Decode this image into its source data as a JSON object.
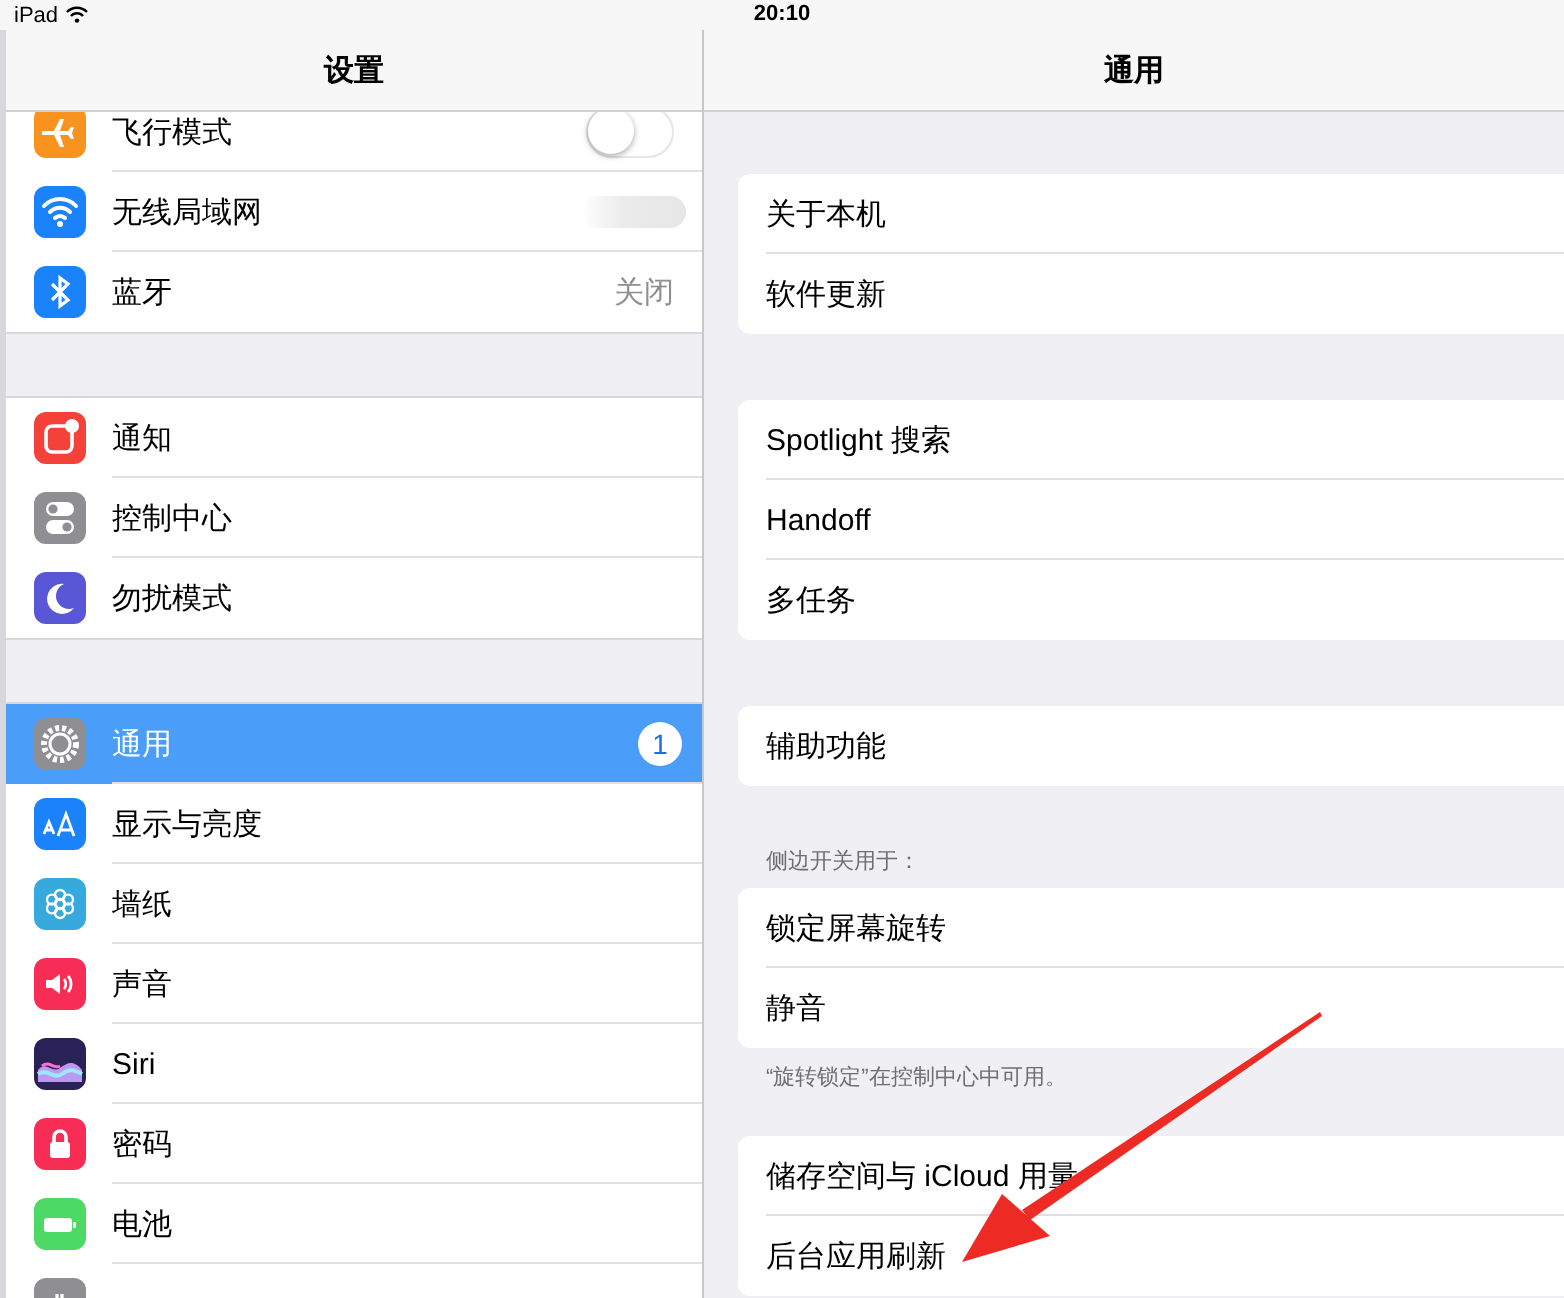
{
  "status_bar": {
    "device": "iPad",
    "time": "20:10"
  },
  "sidebar": {
    "title": "设置",
    "groups": [
      {
        "items": [
          {
            "kind": "airplane",
            "color": "#f7931e",
            "label": "飞行模式",
            "selected": false,
            "toggle": {
              "on": false
            }
          },
          {
            "kind": "wifi",
            "color": "#1a82fb",
            "label": "无线局域网",
            "selected": false,
            "blurred": true
          },
          {
            "kind": "bluetooth",
            "color": "#1a82fb",
            "label": "蓝牙",
            "selected": false,
            "value": "关闭"
          }
        ]
      },
      {
        "items": [
          {
            "kind": "notice",
            "color": "#f4413a",
            "label": "通知",
            "selected": false
          },
          {
            "kind": "switches",
            "color": "#8e8e93",
            "label": "控制中心",
            "selected": false
          },
          {
            "kind": "moon",
            "color": "#5a57d6",
            "label": "勿扰模式",
            "selected": false
          }
        ]
      },
      {
        "items": [
          {
            "kind": "gear",
            "color": "#8e8e93",
            "label": "通用",
            "selected": true,
            "badge": "1"
          },
          {
            "kind": "text-size",
            "color": "#1a82fb",
            "label": "显示与亮度",
            "selected": false
          },
          {
            "kind": "flower",
            "color": "#36aadc",
            "label": "墙纸",
            "selected": false
          },
          {
            "kind": "speaker",
            "color": "#f72d55",
            "label": "声音",
            "selected": false
          },
          {
            "kind": "siri",
            "color": "#2a2257",
            "label": "Siri",
            "selected": false
          },
          {
            "kind": "lock",
            "color": "#f72d55",
            "label": "密码",
            "selected": false
          },
          {
            "kind": "battery",
            "color": "#4cd964",
            "label": "电池",
            "selected": false
          },
          {
            "kind": "hand",
            "color": "#8e8e93",
            "selected": false
          }
        ]
      }
    ]
  },
  "detail": {
    "title": "通用",
    "groups": [
      {
        "items": [
          {
            "label": "关于本机"
          },
          {
            "label": "软件更新"
          }
        ]
      },
      {
        "items": [
          {
            "label": "Spotlight 搜索"
          },
          {
            "label": "Handoff"
          },
          {
            "label": "多任务"
          }
        ]
      },
      {
        "items": [
          {
            "label": "辅助功能"
          }
        ]
      },
      {
        "header": "侧边开关用于：",
        "footer": "“旋转锁定”在控制中心中可用。",
        "items": [
          {
            "label": "锁定屏幕旋转"
          },
          {
            "label": "静音"
          }
        ]
      },
      {
        "items": [
          {
            "label": "储存空间与 iCloud 用量"
          },
          {
            "label": "后台应用刷新"
          }
        ]
      }
    ]
  }
}
